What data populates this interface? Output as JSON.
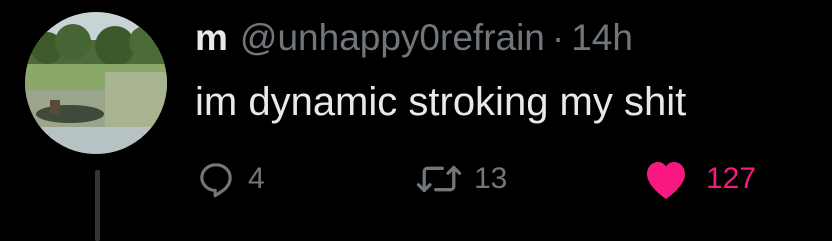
{
  "tweet": {
    "display_name": "m",
    "handle": "@unhappy0refrain",
    "separator": "·",
    "timestamp": "14h",
    "text": "im dynamic stroking my shit"
  },
  "actions": {
    "reply_count": "4",
    "retweet_count": "13",
    "like_count": "127"
  },
  "colors": {
    "background": "#000000",
    "primary_text": "#e7e9ea",
    "secondary_text": "#71767b",
    "like_active": "#f91880",
    "thread_line": "#333639"
  },
  "icons": {
    "reply": "speech-bubble-icon",
    "retweet": "retweet-arrows-icon",
    "like": "heart-filled-icon"
  }
}
